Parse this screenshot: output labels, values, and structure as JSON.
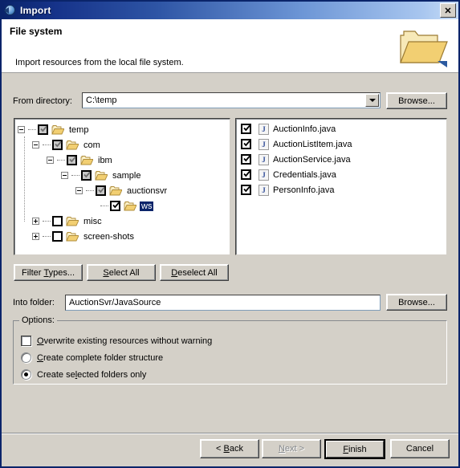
{
  "window": {
    "title": "Import",
    "title_icon": "import-arrow-globe-icon",
    "close_label": "✕"
  },
  "banner": {
    "title": "File system",
    "description": "Import resources from the local file system.",
    "icon": "open-folder-icon"
  },
  "from_directory": {
    "label": "From directory:",
    "value": "C:\\temp",
    "browse_label": "Browse..."
  },
  "tree": {
    "items": [
      {
        "label": "temp",
        "depth": 0,
        "expander": "minus",
        "check": "gray",
        "selected": false
      },
      {
        "label": "com",
        "depth": 1,
        "expander": "minus",
        "check": "gray",
        "selected": false
      },
      {
        "label": "ibm",
        "depth": 2,
        "expander": "minus",
        "check": "gray",
        "selected": false
      },
      {
        "label": "sample",
        "depth": 3,
        "expander": "minus",
        "check": "gray",
        "selected": false
      },
      {
        "label": "auctionsvr",
        "depth": 4,
        "expander": "minus",
        "check": "gray",
        "selected": false
      },
      {
        "label": "ws",
        "depth": 5,
        "expander": "none",
        "check": "black",
        "selected": true
      },
      {
        "label": "misc",
        "depth": 1,
        "expander": "plus",
        "check": "empty",
        "selected": false
      },
      {
        "label": "screen-shots",
        "depth": 1,
        "expander": "plus",
        "check": "empty",
        "selected": false
      }
    ]
  },
  "files": {
    "items": [
      {
        "name": "AuctionInfo.java",
        "checked": true,
        "icon": "java-file-icon"
      },
      {
        "name": "AuctionListItem.java",
        "checked": true,
        "icon": "java-file-icon"
      },
      {
        "name": "AuctionService.java",
        "checked": true,
        "icon": "java-file-icon"
      },
      {
        "name": "Credentials.java",
        "checked": true,
        "icon": "java-file-icon"
      },
      {
        "name": "PersonInfo.java",
        "checked": true,
        "icon": "java-file-icon"
      }
    ]
  },
  "mid_buttons": {
    "filter_types": "Filter Types...",
    "select_all": "Select All",
    "deselect_all": "Deselect All"
  },
  "into_folder": {
    "label": "Into folder:",
    "value": "AuctionSvr/JavaSource",
    "browse_label": "Browse..."
  },
  "options": {
    "legend": "Options:",
    "overwrite": {
      "label": "Overwrite existing resources without warning",
      "checked": false
    },
    "complete_structure": {
      "label": "Create complete folder structure",
      "checked": false
    },
    "selected_only": {
      "label": "Create selected folders only",
      "checked": true
    }
  },
  "footer": {
    "back": "< Back",
    "next": "Next >",
    "finish": "Finish",
    "cancel": "Cancel",
    "next_disabled": true
  },
  "colors": {
    "dialog_bg": "#d4d0c8",
    "title_dark": "#0a246a",
    "title_light": "#c6dcf7",
    "selection": "#0a246a",
    "folder_fill": "#f5dfa3",
    "folder_stroke": "#b08d3a"
  }
}
